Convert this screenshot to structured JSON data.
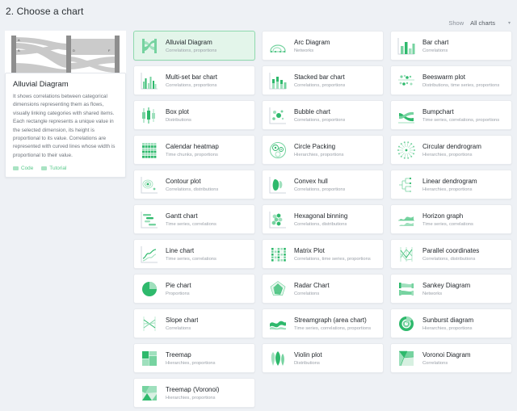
{
  "header": {
    "title": "2. Choose a chart",
    "show_label": "Show",
    "filter_value": "All charts",
    "caret": "▾"
  },
  "preview": {
    "node_labels": [
      "A",
      "B",
      "C",
      "D",
      "E",
      "F",
      "G"
    ]
  },
  "info": {
    "title": "Alluvial Diagram",
    "description": "It shows correlations between categorical dimensions representing them as flows, visually linking categories with shared items. Each rectangle represents a unique value in the selected dimension, its height is proportional to its value. Correlations are represented with curved lines whose width is proportional to their value.",
    "code_label": "Code",
    "tutorial_label": "Tutorial"
  },
  "colors": {
    "accent": "#4fc383",
    "selected_bg": "#e3f5ea",
    "selected_border": "#8fd9ae",
    "page_bg": "#eef1f5",
    "card_bg": "#ffffff",
    "title_text": "#23282d",
    "sub_text": "#9aa0a8"
  },
  "charts": [
    {
      "title": "Alluvial Diagram",
      "sub": "Correlations, proportions",
      "icon": "alluvial-icon",
      "selected": true
    },
    {
      "title": "Arc Diagram",
      "sub": "Networks",
      "icon": "arc-icon",
      "selected": false
    },
    {
      "title": "Bar chart",
      "sub": "Correlations",
      "icon": "bar-icon",
      "selected": false
    },
    {
      "title": "Multi-set bar chart",
      "sub": "Correlations, proportions",
      "icon": "multiset-bar-icon",
      "selected": false
    },
    {
      "title": "Stacked bar chart",
      "sub": "Correlations, proportions",
      "icon": "stacked-bar-icon",
      "selected": false
    },
    {
      "title": "Beeswarm plot",
      "sub": "Distributions, time series, proportions",
      "icon": "beeswarm-icon",
      "selected": false
    },
    {
      "title": "Box plot",
      "sub": "Distributions",
      "icon": "boxplot-icon",
      "selected": false
    },
    {
      "title": "Bubble chart",
      "sub": "Correlations, proportions",
      "icon": "bubble-icon",
      "selected": false
    },
    {
      "title": "Bumpchart",
      "sub": "Time series, correlations, proportions",
      "icon": "bump-icon",
      "selected": false
    },
    {
      "title": "Calendar heatmap",
      "sub": "Time chunks, proportions",
      "icon": "calendar-heatmap-icon",
      "selected": false
    },
    {
      "title": "Circle Packing",
      "sub": "Hierarchies, proportions",
      "icon": "circle-packing-icon",
      "selected": false
    },
    {
      "title": "Circular dendrogram",
      "sub": "Hierarchies, proportions",
      "icon": "circular-dendrogram-icon",
      "selected": false
    },
    {
      "title": "Contour plot",
      "sub": "Correlations, distributions",
      "icon": "contour-icon",
      "selected": false
    },
    {
      "title": "Convex hull",
      "sub": "Correlations, proportions",
      "icon": "convex-hull-icon",
      "selected": false
    },
    {
      "title": "Linear dendrogram",
      "sub": "Hierarchies, proportions",
      "icon": "linear-dendrogram-icon",
      "selected": false
    },
    {
      "title": "Gantt chart",
      "sub": "Time series, correlations",
      "icon": "gantt-icon",
      "selected": false
    },
    {
      "title": "Hexagonal binning",
      "sub": "Correlations, distributions",
      "icon": "hexbin-icon",
      "selected": false
    },
    {
      "title": "Horizon graph",
      "sub": "Time series, correlations",
      "icon": "horizon-icon",
      "selected": false
    },
    {
      "title": "Line chart",
      "sub": "Time series, correlations",
      "icon": "line-icon",
      "selected": false
    },
    {
      "title": "Matrix Plot",
      "sub": "Correlations, time series, proportions",
      "icon": "matrix-icon",
      "selected": false
    },
    {
      "title": "Parallel coordinates",
      "sub": "Correlations, distributions",
      "icon": "parallel-coordinates-icon",
      "selected": false
    },
    {
      "title": "Pie chart",
      "sub": "Proportions",
      "icon": "pie-icon",
      "selected": false
    },
    {
      "title": "Radar Chart",
      "sub": "Correlations",
      "icon": "radar-icon",
      "selected": false
    },
    {
      "title": "Sankey Diagram",
      "sub": "Networks",
      "icon": "sankey-icon",
      "selected": false
    },
    {
      "title": "Slope chart",
      "sub": "Correlations",
      "icon": "slope-icon",
      "selected": false
    },
    {
      "title": "Streamgraph (area chart)",
      "sub": "Time series, correlations, proportions",
      "icon": "streamgraph-icon",
      "selected": false
    },
    {
      "title": "Sunburst diagram",
      "sub": "Hierarchies, proportions",
      "icon": "sunburst-icon",
      "selected": false
    },
    {
      "title": "Treemap",
      "sub": "Hierarchies, proportions",
      "icon": "treemap-icon",
      "selected": false
    },
    {
      "title": "Violin plot",
      "sub": "Distributions",
      "icon": "violin-icon",
      "selected": false
    },
    {
      "title": "Voronoi Diagram",
      "sub": "Correlations",
      "icon": "voronoi-icon",
      "selected": false
    },
    {
      "title": "Treemap (Voronoi)",
      "sub": "Hierarchies, proportions",
      "icon": "treemap-voronoi-icon",
      "selected": false
    }
  ]
}
